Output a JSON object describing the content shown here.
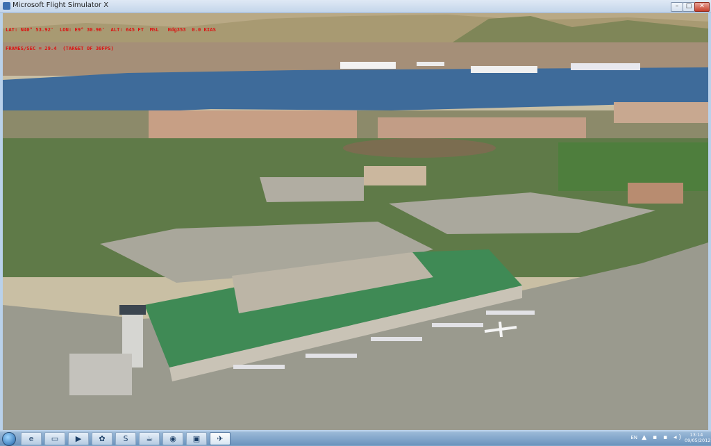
{
  "window": {
    "title": "Microsoft Flight Simulator X",
    "controls": {
      "minimize": "–",
      "maximize": "□",
      "close": "✕"
    }
  },
  "hud": {
    "line1": "LAT: N40° 53.92'  LON: E9° 30.96'  ALT: 645 FT  MSL   Hdg353  0.0 KIAS",
    "line2": "FRAMES/SEC = 29.4  (TARGET OF 30FPS)"
  },
  "taskbar": {
    "pinned": [
      {
        "name": "internet-explorer",
        "glyph": "e"
      },
      {
        "name": "file-explorer",
        "glyph": "▭"
      },
      {
        "name": "media-player",
        "glyph": "▶"
      },
      {
        "name": "messenger",
        "glyph": "✿"
      },
      {
        "name": "skype",
        "glyph": "S"
      },
      {
        "name": "java-app",
        "glyph": "☕"
      },
      {
        "name": "chrome",
        "glyph": "◉"
      },
      {
        "name": "photo-viewer",
        "glyph": "▣"
      },
      {
        "name": "flight-simulator",
        "glyph": "✈"
      }
    ],
    "language": "EN",
    "tray_icons": "▲ ▪ ▪ ◂)",
    "time": "13:14",
    "date": "09/05/2012"
  },
  "colors": {
    "sea": "#3e6b9a",
    "terminal_roof": "#3f8a55",
    "apron": "#9a9a8e",
    "hud_text": "#dd1111"
  }
}
